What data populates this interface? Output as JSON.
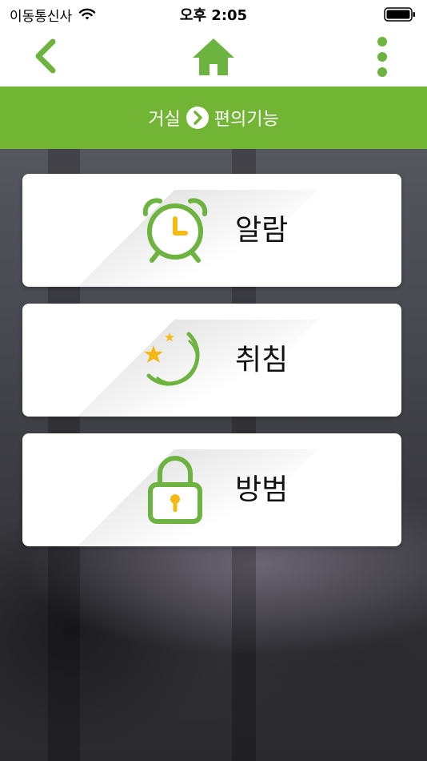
{
  "status_bar": {
    "carrier": "이동통신사",
    "time": "오후 2:05"
  },
  "breadcrumb": {
    "parent": "거실",
    "current": "편의기능"
  },
  "menu": {
    "items": [
      {
        "label": "알람",
        "icon": "alarm-clock-icon"
      },
      {
        "label": "취침",
        "icon": "moon-stars-icon"
      },
      {
        "label": "방범",
        "icon": "padlock-icon"
      }
    ]
  },
  "colors": {
    "accent_green": "#72b434",
    "icon_green": "#6db33f",
    "icon_yellow": "#f5b915"
  }
}
